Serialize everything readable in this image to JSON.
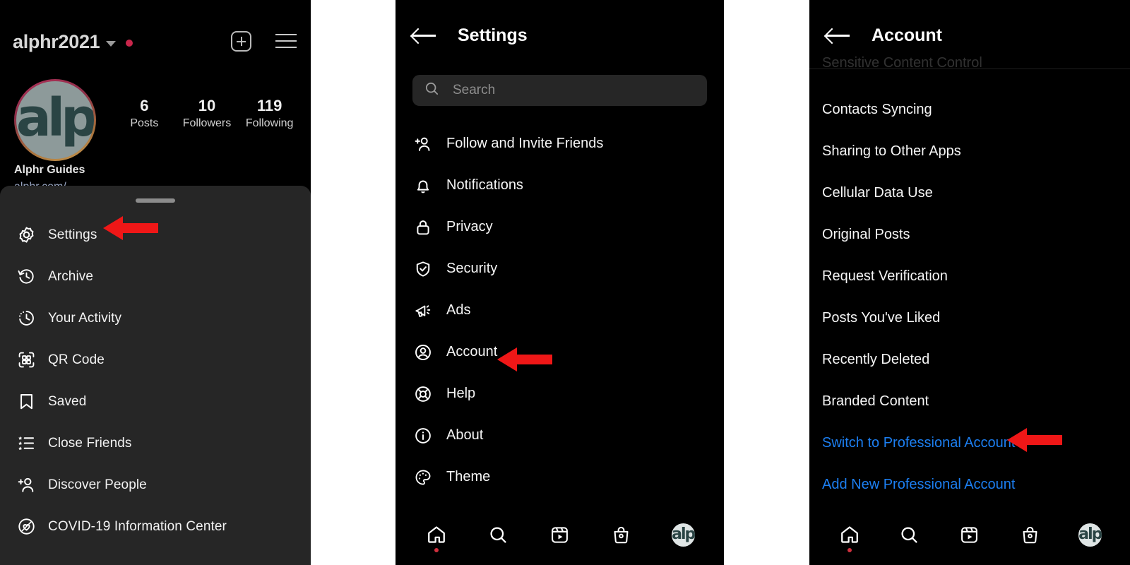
{
  "accent": {
    "red_arrow": "#ef1717",
    "link_blue": "#1c7ff2",
    "badge_red": "#c9264b",
    "sheet_bg": "#262626",
    "screen_bg": "#000000"
  },
  "profile": {
    "username": "alphr2021",
    "has_unread_badge": true,
    "icons": {
      "chevron": "chevron-down-icon",
      "add": "add-post-icon",
      "menu": "hamburger-menu-icon"
    },
    "avatar_text": "alp",
    "stats": [
      {
        "value": "6",
        "label": "Posts"
      },
      {
        "value": "10",
        "label": "Followers"
      },
      {
        "value": "119",
        "label": "Following"
      }
    ],
    "bio_name": "Alphr Guides",
    "bio_url": "alphr.com/",
    "sheet": {
      "items": [
        {
          "label": "Settings",
          "icon": "gear-icon"
        },
        {
          "label": "Archive",
          "icon": "archive-clock-icon"
        },
        {
          "label": "Your Activity",
          "icon": "activity-clock-icon"
        },
        {
          "label": "QR Code",
          "icon": "qr-code-icon"
        },
        {
          "label": "Saved",
          "icon": "bookmark-icon"
        },
        {
          "label": "Close Friends",
          "icon": "close-friends-list-icon"
        },
        {
          "label": "Discover People",
          "icon": "add-person-icon"
        },
        {
          "label": "COVID-19 Information Center",
          "icon": "covid-heart-icon"
        }
      ]
    }
  },
  "settings": {
    "title": "Settings",
    "back_icon": "back-arrow-icon",
    "search": {
      "placeholder": "Search",
      "value": "",
      "icon": "search-icon"
    },
    "items": [
      {
        "label": "Follow and Invite Friends",
        "icon": "add-person-icon"
      },
      {
        "label": "Notifications",
        "icon": "bell-icon"
      },
      {
        "label": "Privacy",
        "icon": "lock-icon"
      },
      {
        "label": "Security",
        "icon": "shield-check-icon"
      },
      {
        "label": "Ads",
        "icon": "megaphone-icon"
      },
      {
        "label": "Account",
        "icon": "account-circle-icon"
      },
      {
        "label": "Help",
        "icon": "lifebuoy-icon"
      },
      {
        "label": "About",
        "icon": "info-circle-icon"
      },
      {
        "label": "Theme",
        "icon": "palette-icon"
      }
    ]
  },
  "account": {
    "title": "Account",
    "back_icon": "back-arrow-icon",
    "cut_off_item": "Sensitive Content Control",
    "items": [
      {
        "label": "Contacts Syncing",
        "link": false
      },
      {
        "label": "Sharing to Other Apps",
        "link": false
      },
      {
        "label": "Cellular Data Use",
        "link": false
      },
      {
        "label": "Original Posts",
        "link": false
      },
      {
        "label": "Request Verification",
        "link": false
      },
      {
        "label": "Posts You've Liked",
        "link": false
      },
      {
        "label": "Recently Deleted",
        "link": false
      },
      {
        "label": "Branded Content",
        "link": false
      },
      {
        "label": "Switch to Professional Account",
        "link": true
      },
      {
        "label": "Add New Professional Account",
        "link": true
      }
    ]
  },
  "bottom_nav": {
    "items": [
      {
        "icon": "home-icon",
        "badge": true
      },
      {
        "icon": "search-icon",
        "badge": false
      },
      {
        "icon": "reels-icon",
        "badge": false
      },
      {
        "icon": "shop-bag-icon",
        "badge": false
      },
      {
        "icon": "profile-avatar-icon",
        "badge": false,
        "text": "alp"
      }
    ]
  },
  "annotations": [
    {
      "name": "arrow-to-settings",
      "points_to": "Settings"
    },
    {
      "name": "arrow-to-account",
      "points_to": "Account"
    },
    {
      "name": "arrow-to-switch-pro",
      "points_to": "Switch to Professional Account"
    }
  ]
}
